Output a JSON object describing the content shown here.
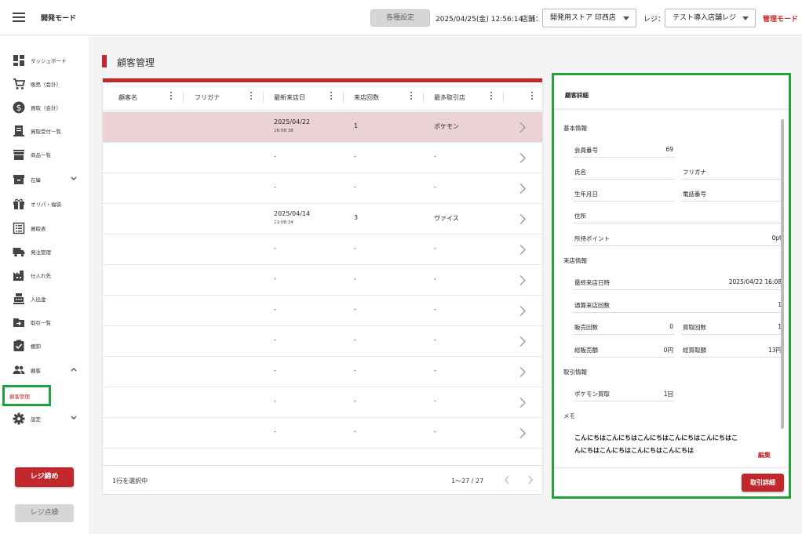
{
  "header": {
    "app_title": "開発モード",
    "settings_button": "各種設定",
    "datetime": "2025/04/25(金) 12:56:14",
    "store_label": "店舗：",
    "store_value": "開発用ストア 印西店",
    "register_label": "レジ：",
    "register_value": "テスト導入店舗レジ",
    "mode_link": "管理モード"
  },
  "sidebar": {
    "items": [
      {
        "label": "ダッシュボード",
        "icon": "dashboard-icon"
      },
      {
        "label": "販売（会計）",
        "icon": "cart-icon"
      },
      {
        "label": "買取（会計）",
        "icon": "dollar-icon"
      },
      {
        "label": "買取受付一覧",
        "icon": "receipt-icon"
      },
      {
        "label": "商品一覧",
        "icon": "store-icon"
      },
      {
        "label": "在庫",
        "icon": "archive-icon"
      },
      {
        "label": "オリパ・福袋",
        "icon": "gift-icon"
      },
      {
        "label": "買取表",
        "icon": "list-icon"
      },
      {
        "label": "発注管理",
        "icon": "truck-icon"
      },
      {
        "label": "仕入れ先",
        "icon": "factory-icon"
      },
      {
        "label": "入出金",
        "icon": "register-icon"
      },
      {
        "label": "取引一覧",
        "icon": "transfer-icon"
      },
      {
        "label": "棚卸",
        "icon": "check-icon"
      },
      {
        "label": "顧客",
        "icon": "people-icon"
      },
      {
        "label": "設定",
        "icon": "gear-icon"
      }
    ],
    "active_item": "顧客管理",
    "close_register_button": "レジ締め",
    "check_register_button": "レジ点検"
  },
  "page": {
    "title": "顧客管理"
  },
  "table": {
    "columns": [
      "顧客名",
      "フリガナ",
      "最新来店日",
      "来店回数",
      "最多取引店"
    ],
    "rows": [
      {
        "name": "",
        "kana": "",
        "date": "2025/04/22",
        "time": "16:08:38",
        "visits": "1",
        "store": "ポケモン",
        "selected": true
      },
      {
        "name": "",
        "kana": "",
        "date": "-",
        "time": "",
        "visits": "-",
        "store": "-"
      },
      {
        "name": "",
        "kana": "",
        "date": "-",
        "time": "",
        "visits": "-",
        "store": "-"
      },
      {
        "name": "",
        "kana": "",
        "date": "2025/04/14",
        "time": "11:08:34",
        "visits": "3",
        "store": "ヴァイス"
      },
      {
        "name": "",
        "kana": "",
        "date": "-",
        "time": "",
        "visits": "-",
        "store": "-"
      },
      {
        "name": "",
        "kana": "",
        "date": "-",
        "time": "",
        "visits": "-",
        "store": "-"
      },
      {
        "name": "",
        "kana": "",
        "date": "-",
        "time": "",
        "visits": "-",
        "store": "-"
      },
      {
        "name": "",
        "kana": "",
        "date": "-",
        "time": "",
        "visits": "-",
        "store": "-"
      },
      {
        "name": "",
        "kana": "",
        "date": "-",
        "time": "",
        "visits": "-",
        "store": "-"
      },
      {
        "name": "",
        "kana": "",
        "date": "-",
        "time": "",
        "visits": "-",
        "store": "-"
      },
      {
        "name": "",
        "kana": "",
        "date": "-",
        "time": "",
        "visits": "-",
        "store": "-"
      }
    ],
    "selection_text": "1行を選択中",
    "pagination": "1〜27 / 27"
  },
  "detail": {
    "title": "顧客詳細",
    "basic_section": "基本情報",
    "member_no_label": "会員番号",
    "member_no_value": "69",
    "name_label": "氏名",
    "kana_label": "フリガナ",
    "birth_label": "生年月日",
    "phone_label": "電話番号",
    "address_label": "住所",
    "points_label": "所持ポイント",
    "points_value": "0pt",
    "visit_section": "来店情報",
    "last_visit_label": "最終来店日時",
    "last_visit_value": "2025/04/22 16:08",
    "total_visits_label": "通算来店回数",
    "total_visits_value": "1",
    "sale_count_label": "販売回数",
    "sale_count_value": "0",
    "buy_count_label": "買取回数",
    "buy_count_value": "1",
    "sale_total_label": "総販売額",
    "sale_total_value": "0円",
    "buy_total_label": "総買取額",
    "buy_total_value": "13円",
    "trade_section": "取引情報",
    "trade_label": "ポケモン買取",
    "trade_value": "1回",
    "memo_section": "メモ",
    "memo_text": "こんにちはこんにちはこんにちはこんにちはこんにちはこんにちはこんにちはこんにちはこんにちは",
    "edit_link": "編集",
    "trade_detail_button": "取引詳細"
  }
}
